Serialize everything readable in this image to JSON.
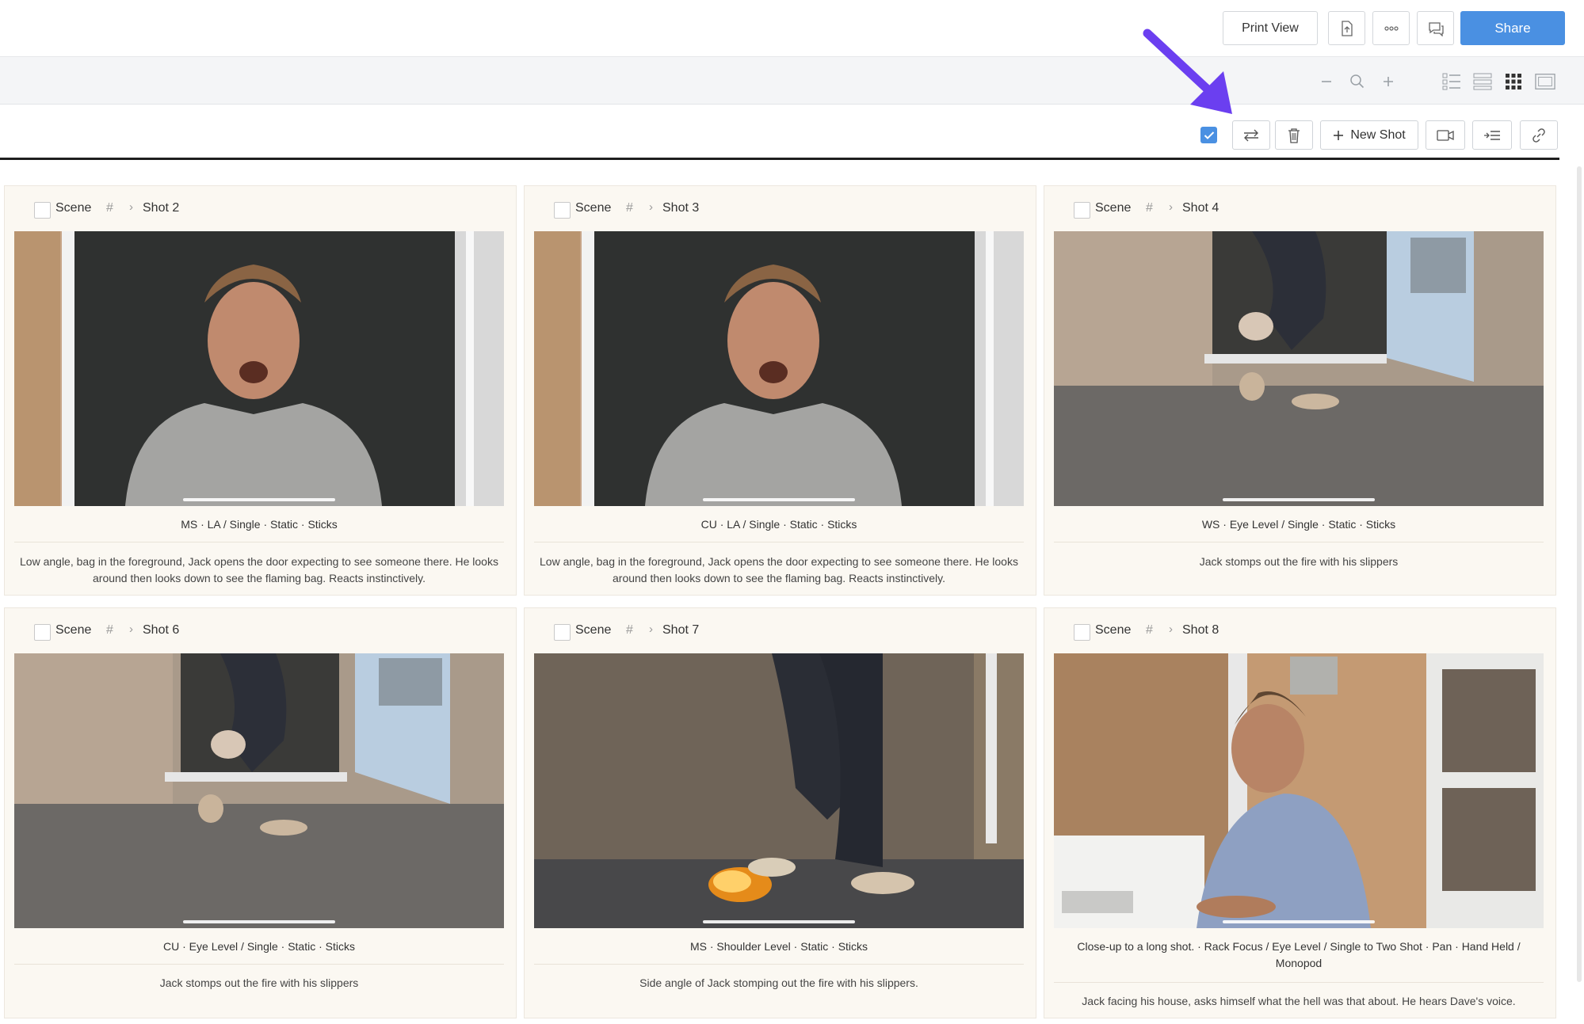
{
  "header": {
    "print_view_label": "Print View",
    "share_label": "Share"
  },
  "toolbar": {
    "new_shot_label": "New Shot"
  },
  "cards": [
    {
      "scene": "Scene",
      "hash": "#",
      "shot": "Shot 2",
      "meta": "MS  ·  LA / Single  ·  Static  ·  Sticks",
      "description": "Low angle, bag in the foreground, Jack opens the door expecting to see someone there. He looks around then looks down to see the flaming bag. Reacts instinctively."
    },
    {
      "scene": "Scene",
      "hash": "#",
      "shot": "Shot 3",
      "meta": "CU  ·  LA / Single  ·  Static  ·  Sticks",
      "description": "Low angle, bag in the foreground, Jack opens the door expecting to see someone there. He looks around then looks down to see the flaming bag. Reacts instinctively."
    },
    {
      "scene": "Scene",
      "hash": "#",
      "shot": "Shot 4",
      "meta": "WS  ·  Eye Level / Single  ·  Static  ·  Sticks",
      "description": "Jack stomps out the fire with his slippers"
    },
    {
      "scene": "Scene",
      "hash": "#",
      "shot": "Shot 6",
      "meta": "CU  ·  Eye Level / Single  ·  Static  ·  Sticks",
      "description": "Jack stomps out the fire with his slippers"
    },
    {
      "scene": "Scene",
      "hash": "#",
      "shot": "Shot 7",
      "meta": "MS  ·  Shoulder Level  ·  Static  ·  Sticks",
      "description": "Side angle of Jack stomping out the fire with his slippers."
    },
    {
      "scene": "Scene",
      "hash": "#",
      "shot": "Shot 8",
      "meta": "Close-up to a long shot.  ·  Rack Focus / Eye Level / Single to Two Shot  ·  Pan  ·  Hand Held / Monopod",
      "description": "Jack facing his house, asks himself what the hell was that about. He hears Dave's voice."
    }
  ],
  "colors": {
    "accent": "#4a90e2",
    "annotation_arrow": "#6b3ff0",
    "card_bg": "#fbf8f2"
  }
}
